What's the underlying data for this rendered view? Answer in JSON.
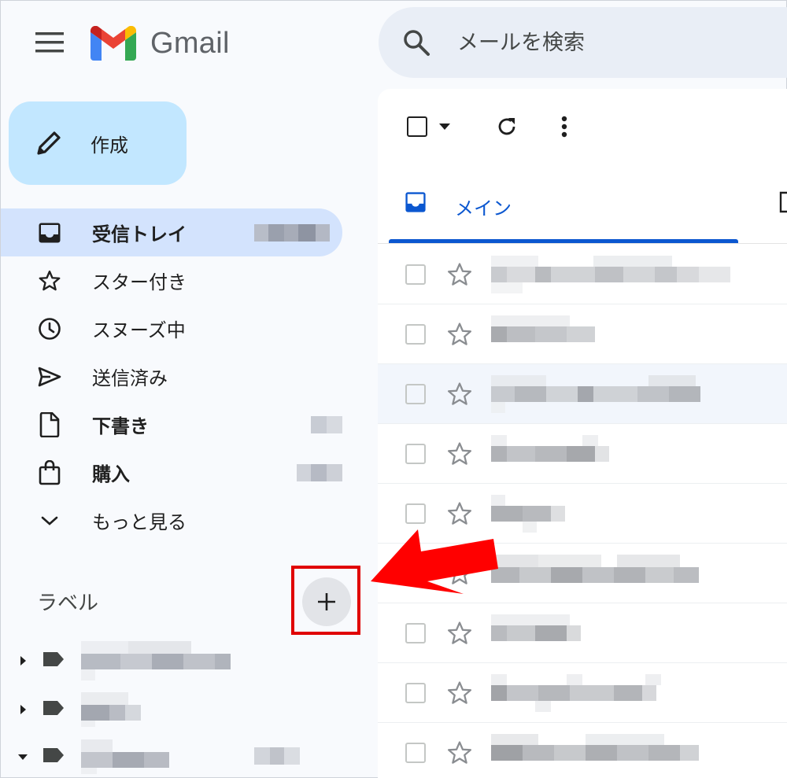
{
  "header": {
    "app_name": "Gmail",
    "search_placeholder": "メールを検索"
  },
  "compose": {
    "label": "作成"
  },
  "nav": {
    "items": [
      {
        "label": "受信トレイ",
        "icon": "inbox-icon",
        "active": true,
        "bold": true
      },
      {
        "label": "スター付き",
        "icon": "star-icon",
        "active": false,
        "bold": false
      },
      {
        "label": "スヌーズ中",
        "icon": "clock-icon",
        "active": false,
        "bold": false
      },
      {
        "label": "送信済み",
        "icon": "send-icon",
        "active": false,
        "bold": false
      },
      {
        "label": "下書き",
        "icon": "draft-icon",
        "active": false,
        "bold": true
      },
      {
        "label": "購入",
        "icon": "shopping-bag-icon",
        "active": false,
        "bold": true
      },
      {
        "label": "もっと見る",
        "icon": "chevron-down-icon",
        "active": false,
        "bold": false
      }
    ]
  },
  "labels": {
    "title": "ラベル",
    "add_icon": "plus-icon"
  },
  "tabs": {
    "main_label": "メイン"
  },
  "colors": {
    "accent": "#0b57d0",
    "compose_bg": "#c2e7ff",
    "active_nav": "#d3e3fd",
    "highlight_red": "#e00000"
  }
}
